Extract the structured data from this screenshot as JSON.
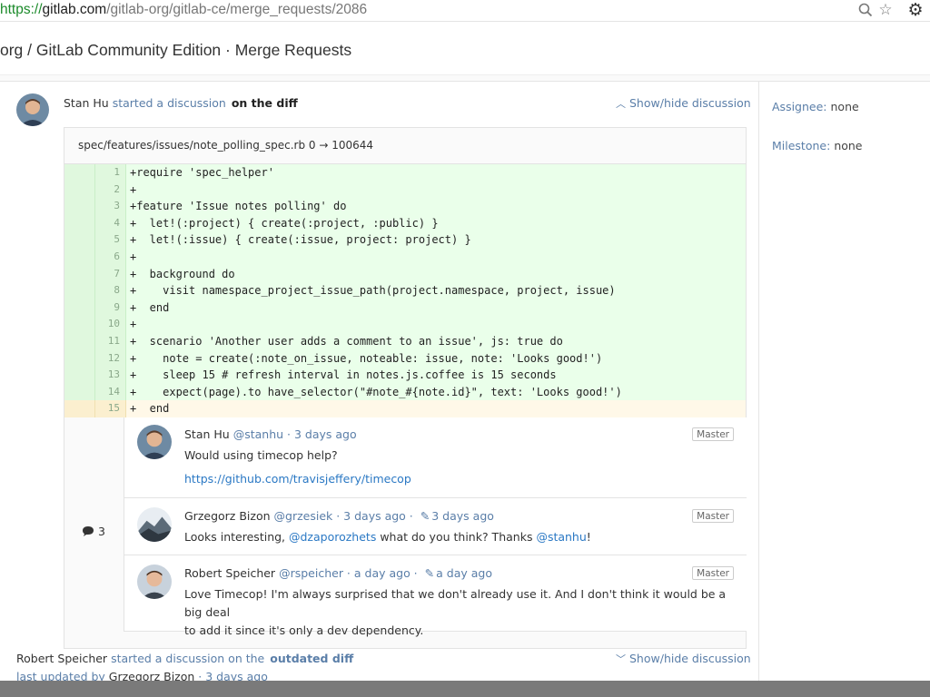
{
  "browser": {
    "url_scheme": "https://",
    "url_host": "gitlab.com",
    "url_path": "/gitlab-org/gitlab-ce/merge_requests/2086",
    "icons": [
      "magnifier-icon",
      "star-icon",
      "gear-icon"
    ]
  },
  "page": {
    "title": "org / GitLab Community Edition · Merge Requests"
  },
  "sidebar": {
    "assignee_label": "Assignee:",
    "assignee_value": "none",
    "milestone_label": "Milestone:",
    "milestone_value": "none"
  },
  "discussion": {
    "author": "Stan Hu",
    "action": "started a discussion",
    "target": "on the diff",
    "toggle_label": "Show/hide discussion",
    "file_header": "spec/features/issues/note_polling_spec.rb 0 → 100644",
    "code_lines": [
      {
        "num": "1",
        "text": "+require 'spec_helper'"
      },
      {
        "num": "2",
        "text": "+"
      },
      {
        "num": "3",
        "text": "+feature 'Issue notes polling' do"
      },
      {
        "num": "4",
        "text": "+  let!(:project) { create(:project, :public) }"
      },
      {
        "num": "5",
        "text": "+  let!(:issue) { create(:issue, project: project) }"
      },
      {
        "num": "6",
        "text": "+"
      },
      {
        "num": "7",
        "text": "+  background do"
      },
      {
        "num": "8",
        "text": "+    visit namespace_project_issue_path(project.namespace, project, issue)"
      },
      {
        "num": "9",
        "text": "+  end"
      },
      {
        "num": "10",
        "text": "+"
      },
      {
        "num": "11",
        "text": "+  scenario 'Another user adds a comment to an issue', js: true do"
      },
      {
        "num": "12",
        "text": "+    note = create(:note_on_issue, noteable: issue, note: 'Looks good!')"
      },
      {
        "num": "13",
        "text": "+    sleep 15 # refresh interval in notes.js.coffee is 15 seconds"
      },
      {
        "num": "14",
        "text": "+    expect(page).to have_selector(\"#note_#{note.id}\", text: 'Looks good!')"
      },
      {
        "num": "15",
        "text": "+  end"
      }
    ],
    "comment_count": "3",
    "notes": [
      {
        "name": "Stan Hu",
        "meta": "@stanhu · 3 days ago",
        "badge": "Master",
        "body": "Would using timecop help?",
        "link": "https://github.com/travisjeffery/timecop"
      },
      {
        "name": "Grzegorz Bizon",
        "meta": "@grzesiek · 3 days ago ·",
        "edited": "3 days ago",
        "badge": "Master",
        "body_pre": "Looks interesting, ",
        "mention1": "@dzaporozhets",
        "body_mid": " what do you think? Thanks ",
        "mention2": "@stanhu",
        "body_post": "!"
      },
      {
        "name": "Robert Speicher",
        "meta": "@rspeicher · a day ago ·",
        "edited": "a day ago",
        "badge": "Master",
        "body_line1": "Love Timecop! I'm always surprised that we don't already use it. And I don't think it would be a big deal",
        "body_line2": "to add it since it's only a dev dependency."
      }
    ]
  },
  "discussion2": {
    "author": "Robert Speicher",
    "action": "started a discussion on the",
    "target": "outdated diff",
    "toggle_label": "Show/hide discussion",
    "last_updated_label": "last updated by",
    "last_updated_user": "Grzegorz Bizon",
    "last_updated_time": "· 3 days ago"
  }
}
